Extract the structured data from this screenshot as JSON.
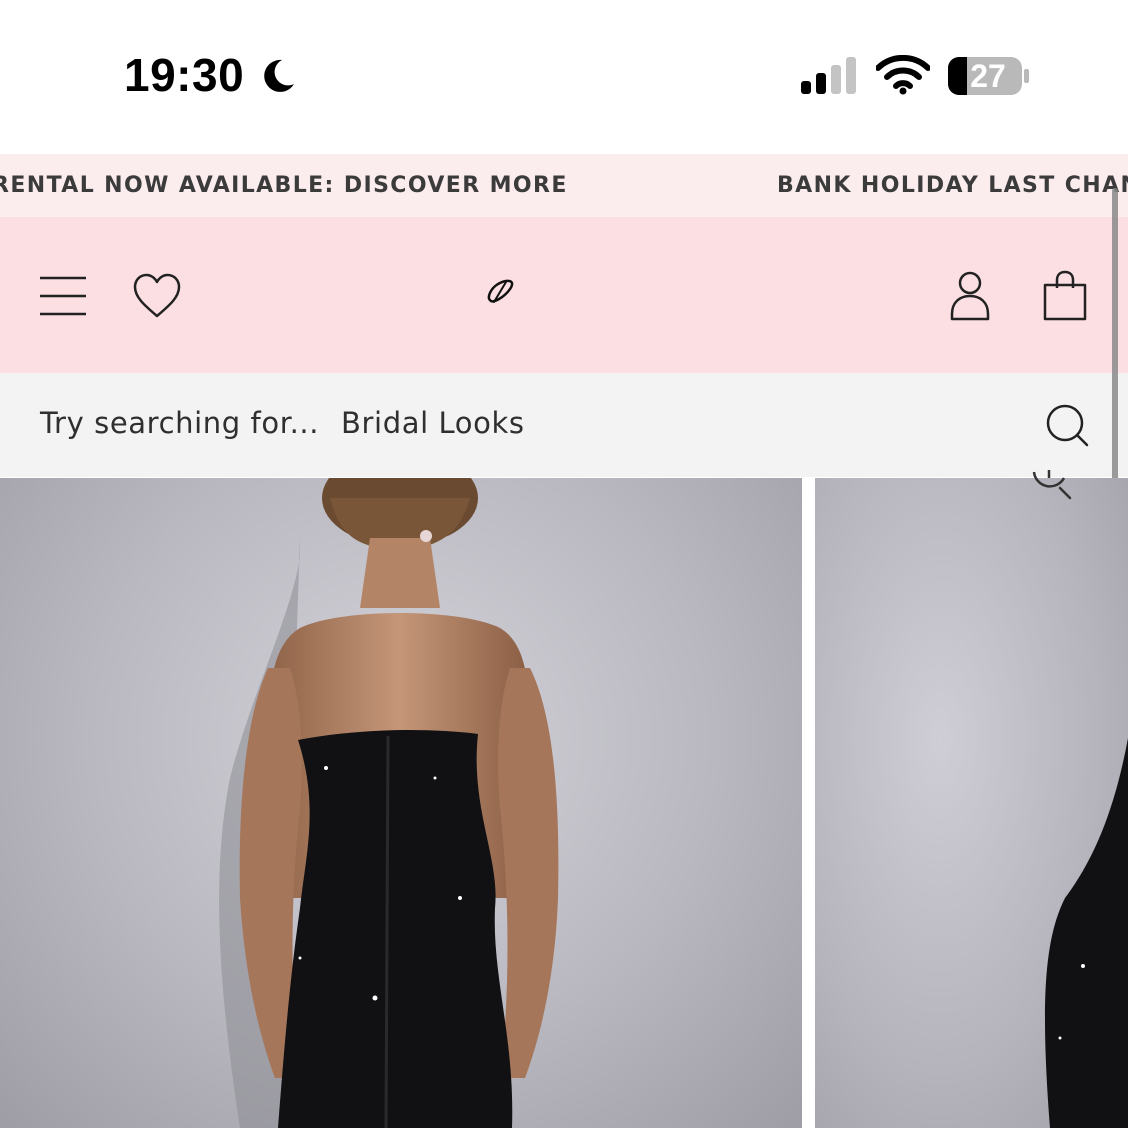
{
  "status_bar": {
    "time": "19:30",
    "battery_level": "27",
    "icons": [
      "moon-icon",
      "signal-icon",
      "wifi-icon",
      "battery-icon"
    ]
  },
  "ticker": {
    "items": [
      "RENTAL NOW AVAILABLE: DISCOVER MORE",
      "BANK HOLIDAY LAST CHANCE"
    ]
  },
  "header": {
    "icons": [
      "menu-icon",
      "heart-icon",
      "logo",
      "account-icon",
      "bag-icon"
    ]
  },
  "search": {
    "prefix": "Try searching for...",
    "suggestion": "Bridal Looks"
  },
  "products": {
    "images": [
      "black strapless sequin maxi dress, back view",
      "black sequin dress, side view"
    ],
    "zoom_icon": "zoom-icon"
  },
  "colors": {
    "ticker_bg": "#fbecee",
    "header_bg": "#fbdfe2",
    "search_bg": "#f3f3f3"
  }
}
